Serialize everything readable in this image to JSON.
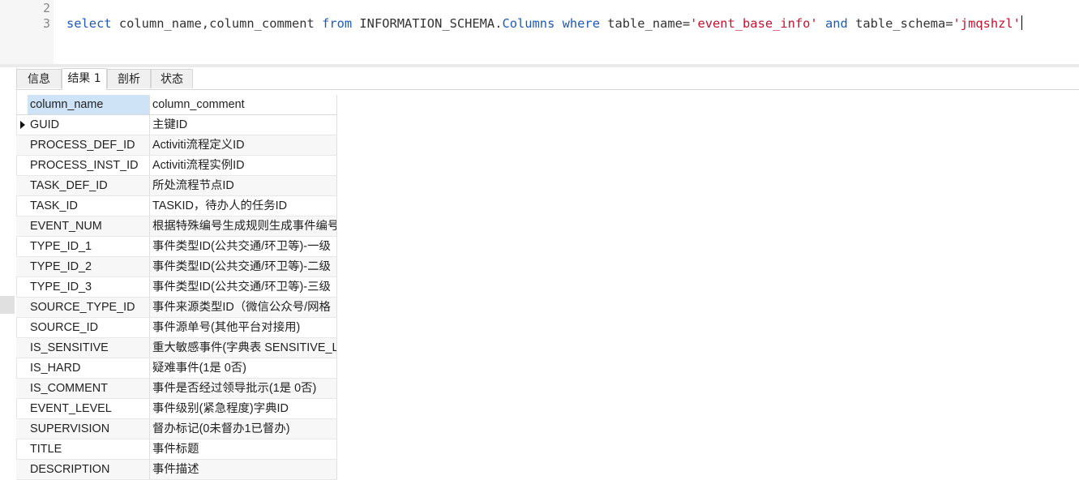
{
  "editor": {
    "line_numbers": [
      "2",
      "3"
    ],
    "sql": {
      "t1": "select",
      "t2": " column_name,column_comment ",
      "t3": "from",
      "t4": " INFORMATION_SCHEMA.",
      "t5": "Columns",
      "t6": " ",
      "t7": "where",
      "t8": " table_name=",
      "t9": "'event_base_info'",
      "t10": " ",
      "t11": "and",
      "t12": " table_schema=",
      "t13": "'jmqshzl'"
    }
  },
  "tabs": [
    {
      "label": "信息",
      "active": false
    },
    {
      "label": "结果 1",
      "active": true
    },
    {
      "label": "剖析",
      "active": false
    },
    {
      "label": "状态",
      "active": false
    }
  ],
  "grid": {
    "columns": [
      "column_name",
      "column_comment"
    ],
    "rows": [
      [
        "GUID",
        "主键ID"
      ],
      [
        "PROCESS_DEF_ID",
        "Activiti流程定义ID"
      ],
      [
        "PROCESS_INST_ID",
        "Activiti流程实例ID"
      ],
      [
        "TASK_DEF_ID",
        "所处流程节点ID"
      ],
      [
        "TASK_ID",
        "TASKID，待办人的任务ID"
      ],
      [
        "EVENT_NUM",
        "根据特殊编号生成规则生成事件编号"
      ],
      [
        "TYPE_ID_1",
        "事件类型ID(公共交通/环卫等)-一级"
      ],
      [
        "TYPE_ID_2",
        "事件类型ID(公共交通/环卫等)-二级"
      ],
      [
        "TYPE_ID_3",
        "事件类型ID(公共交通/环卫等)-三级"
      ],
      [
        "SOURCE_TYPE_ID",
        "事件来源类型ID（微信公众号/网格"
      ],
      [
        "SOURCE_ID",
        "事件源单号(其他平台对接用)"
      ],
      [
        "IS_SENSITIVE",
        "重大敏感事件(字典表 SENSITIVE_L"
      ],
      [
        "IS_HARD",
        "疑难事件(1是 0否)"
      ],
      [
        "IS_COMMENT",
        "事件是否经过领导批示(1是 0否)"
      ],
      [
        "EVENT_LEVEL",
        "事件级别(紧急程度)字典ID"
      ],
      [
        "SUPERVISION",
        "督办标记(0未督办1已督办)"
      ],
      [
        "TITLE",
        "事件标题"
      ],
      [
        "DESCRIPTION",
        "事件描述"
      ]
    ],
    "selected_row": 0
  }
}
